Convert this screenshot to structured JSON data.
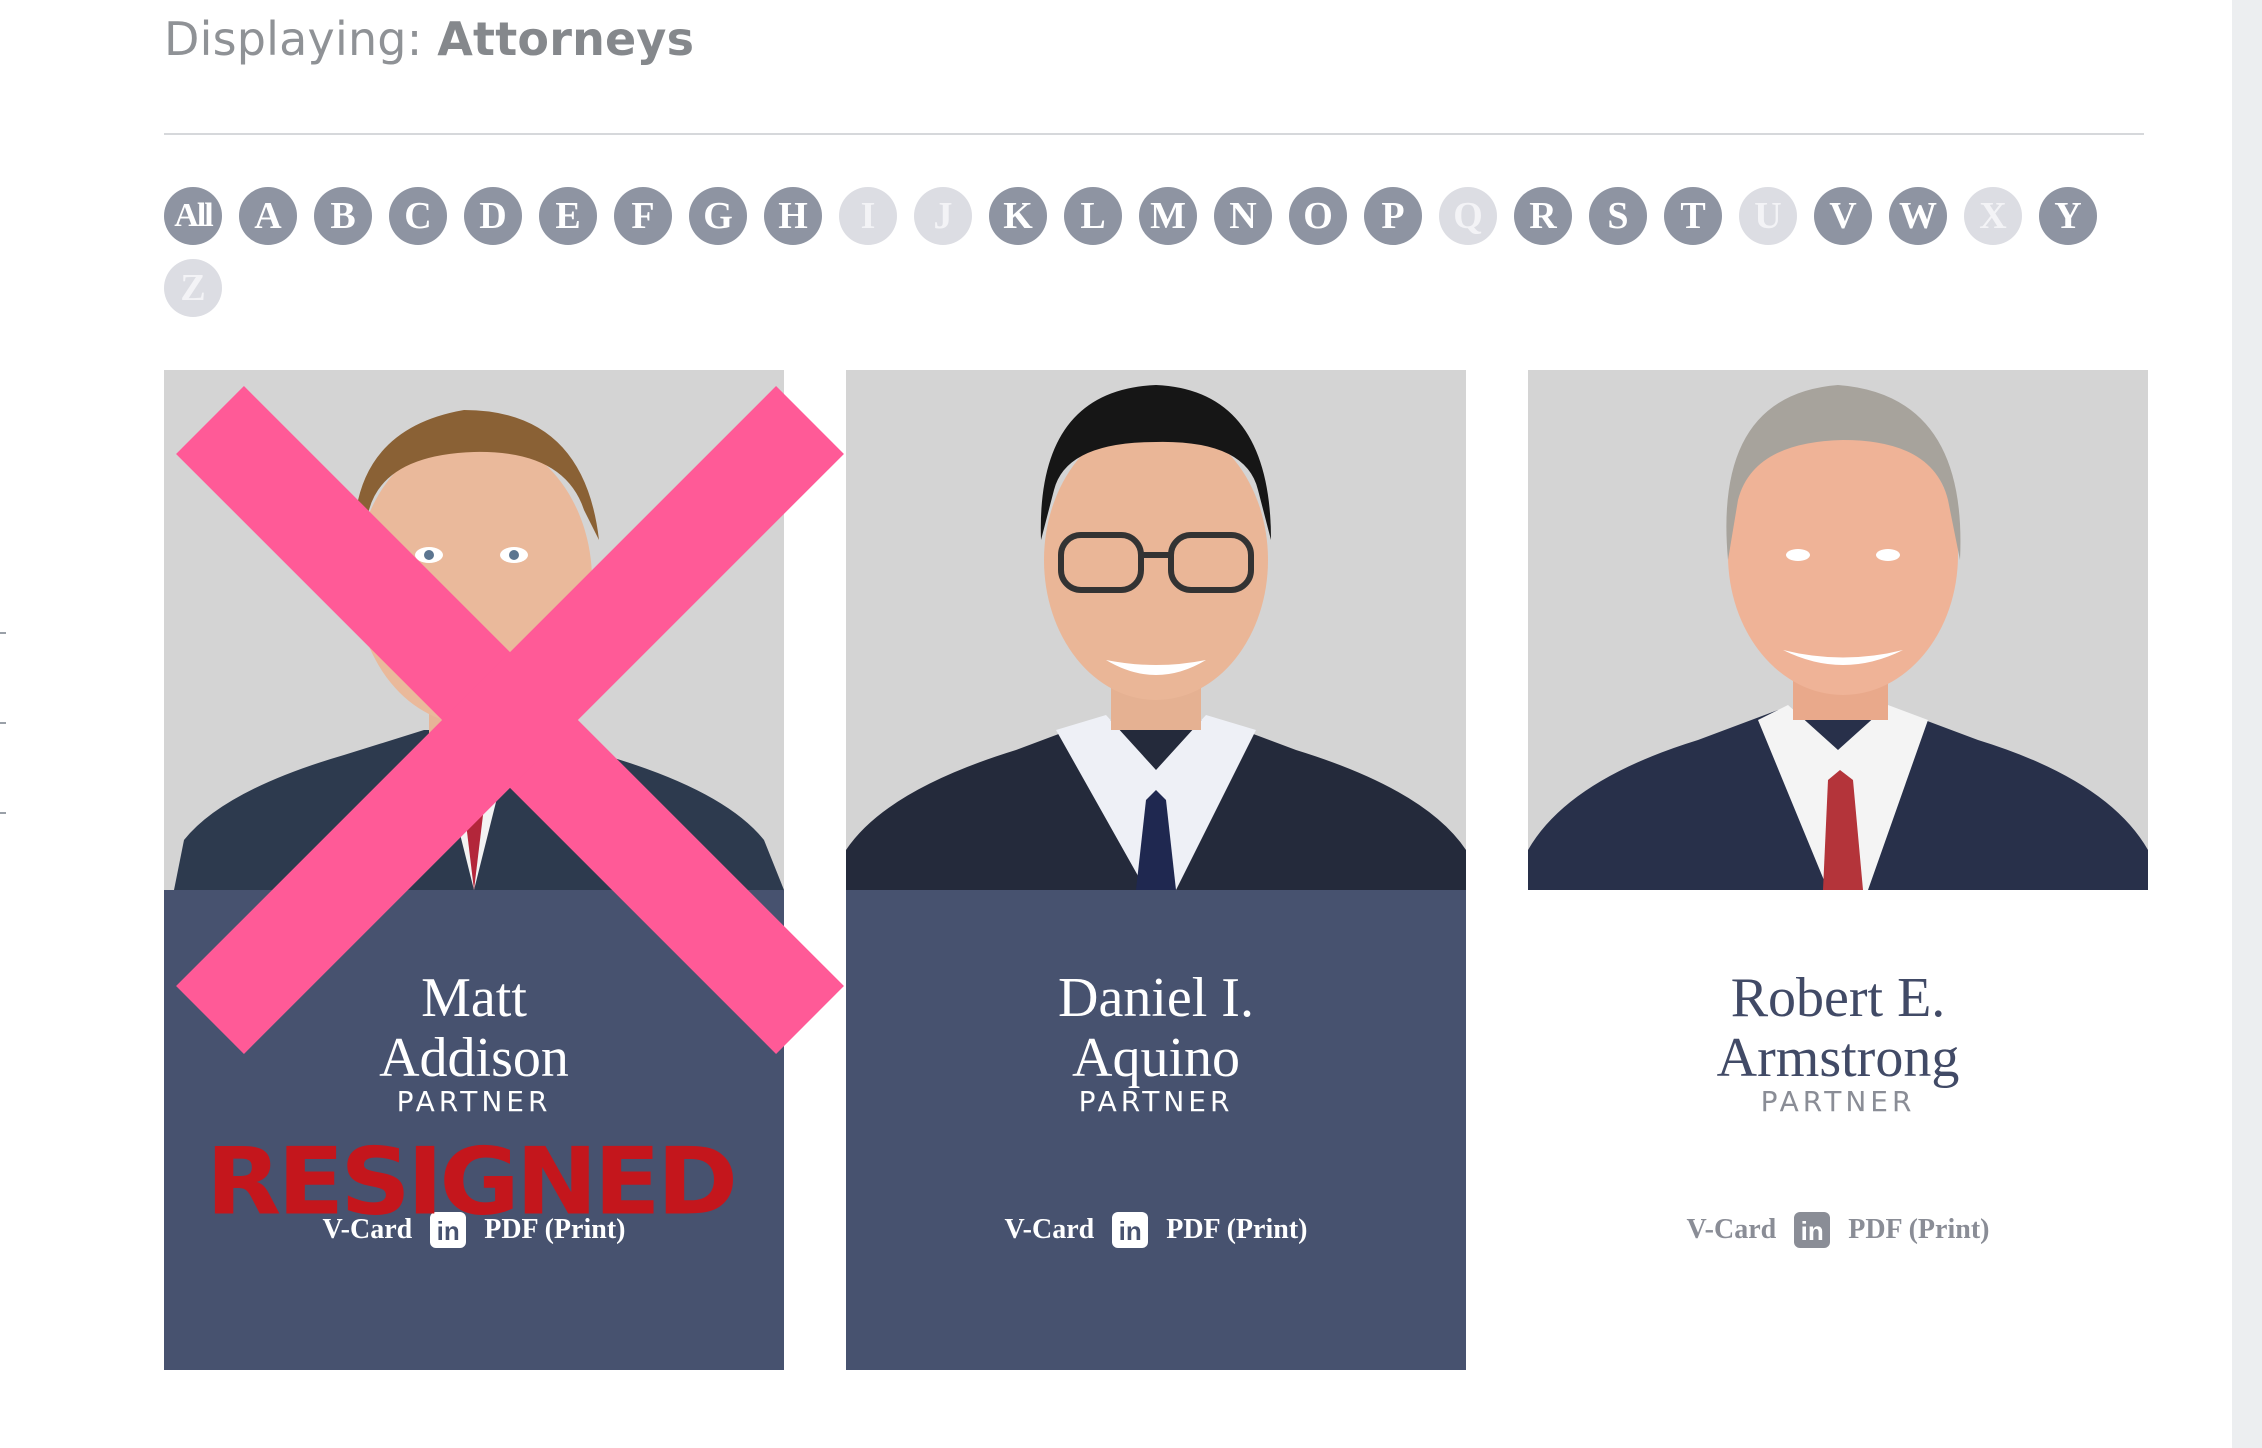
{
  "header": {
    "displaying_label": "Displaying: ",
    "displaying_value": "Attorneys"
  },
  "alphabet": [
    {
      "label": "All",
      "enabled": true
    },
    {
      "label": "A",
      "enabled": true
    },
    {
      "label": "B",
      "enabled": true
    },
    {
      "label": "C",
      "enabled": true
    },
    {
      "label": "D",
      "enabled": true
    },
    {
      "label": "E",
      "enabled": true
    },
    {
      "label": "F",
      "enabled": true
    },
    {
      "label": "G",
      "enabled": true
    },
    {
      "label": "H",
      "enabled": true
    },
    {
      "label": "I",
      "enabled": false
    },
    {
      "label": "J",
      "enabled": false
    },
    {
      "label": "K",
      "enabled": true
    },
    {
      "label": "L",
      "enabled": true
    },
    {
      "label": "M",
      "enabled": true
    },
    {
      "label": "N",
      "enabled": true
    },
    {
      "label": "O",
      "enabled": true
    },
    {
      "label": "P",
      "enabled": true
    },
    {
      "label": "Q",
      "enabled": false
    },
    {
      "label": "R",
      "enabled": true
    },
    {
      "label": "S",
      "enabled": true
    },
    {
      "label": "T",
      "enabled": true
    },
    {
      "label": "U",
      "enabled": false
    },
    {
      "label": "V",
      "enabled": true
    },
    {
      "label": "W",
      "enabled": true
    },
    {
      "label": "X",
      "enabled": false
    },
    {
      "label": "Y",
      "enabled": true
    },
    {
      "label": "Z",
      "enabled": false
    }
  ],
  "attorneys": [
    {
      "name_line1": "Matt",
      "name_line2": "Addison",
      "title": "PARTNER",
      "vcard": "V-Card",
      "linkedin": "in",
      "pdf": "PDF (Print)",
      "overlay_text": "RESIGNED"
    },
    {
      "name_line1": "Daniel I.",
      "name_line2": "Aquino",
      "title": "PARTNER",
      "vcard": "V-Card",
      "linkedin": "in",
      "pdf": "PDF (Print)"
    },
    {
      "name_line1": "Robert E.",
      "name_line2": "Armstrong",
      "title": "PARTNER",
      "vcard": "V-Card",
      "linkedin": "in",
      "pdf": "PDF (Print)"
    }
  ],
  "colors": {
    "card_dark": "#47526f",
    "letter_active": "#8e94a2",
    "letter_disabled": "#dcdde3",
    "x_mark": "#ff5a97",
    "resigned": "#c4161c"
  }
}
